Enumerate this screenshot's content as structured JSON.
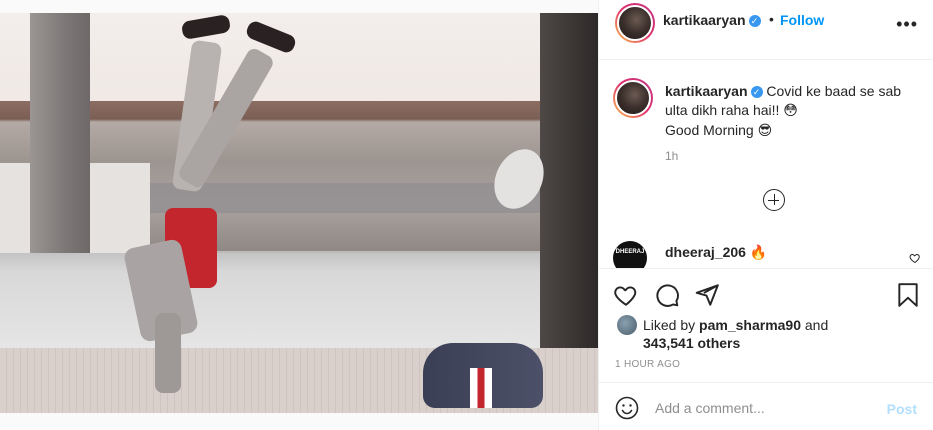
{
  "post": {
    "image_alt": "Person doing a handstand on a rooftop next to a duffel bag"
  },
  "header": {
    "username": "kartikaaryan",
    "verified_mark": "✓",
    "separator": "•",
    "follow_label": "Follow",
    "more_label": "•••"
  },
  "caption": {
    "username": "kartikaaryan",
    "verified_mark": "✓",
    "line1": "Covid ke baad se sab ulta dikh raha hai!!",
    "emoji1": "😳",
    "line2": "Good Morning",
    "emoji2": "😎",
    "timestamp": "1h"
  },
  "comment": {
    "username": "dheeraj_206",
    "emoji": "🔥",
    "avatar_text": "DHEERAJ"
  },
  "likes": {
    "prefix": "Liked by",
    "user": "pam_sharma90",
    "conjunction": "and",
    "count": "343,541 others"
  },
  "time_ago": "1 HOUR AGO",
  "add_comment": {
    "placeholder": "Add a comment...",
    "post_label": "Post"
  },
  "icons": [
    "more-icon",
    "add-comment-icon",
    "heart-icon",
    "comment-icon",
    "share-icon",
    "bookmark-icon",
    "emoji-icon"
  ],
  "colors": {
    "link_blue": "#0095f6",
    "post_disabled": "#b2dffc",
    "text": "#262626",
    "muted": "#8e8e8e"
  }
}
